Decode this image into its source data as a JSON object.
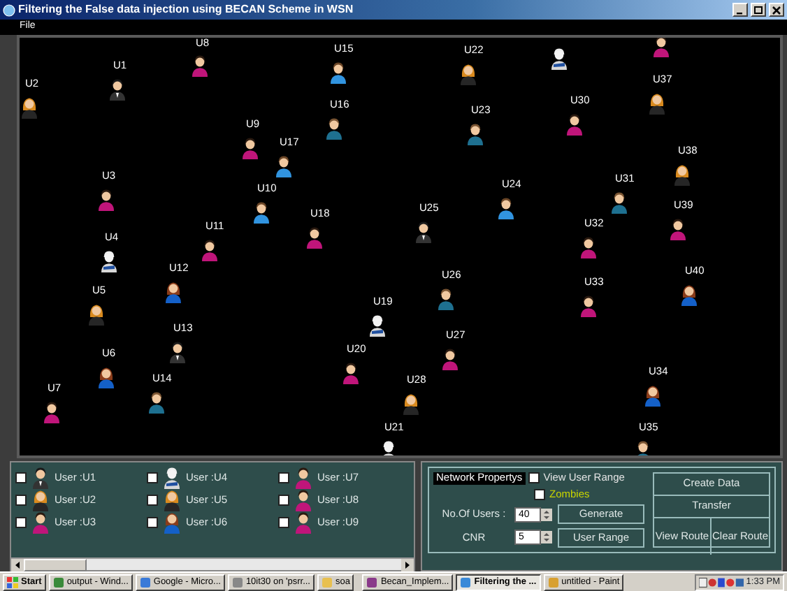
{
  "window": {
    "title": "Filtering the False data injection using BECAN Scheme in WSN"
  },
  "menu": [
    "File"
  ],
  "canvas": {
    "nodes": [
      {
        "label": "U1",
        "kind": "suit"
      },
      {
        "label": "U2",
        "kind": "blonde"
      },
      {
        "label": "U8",
        "kind": "lady"
      },
      {
        "label": "U15",
        "kind": "boy"
      },
      {
        "label": "U22",
        "kind": "blonde"
      },
      {
        "kind": "medic"
      },
      {
        "kind": "lady"
      },
      {
        "label": "U37",
        "kind": "blonde"
      },
      {
        "label": "U16",
        "kind": "man"
      },
      {
        "label": "U23",
        "kind": "man"
      },
      {
        "label": "U30",
        "kind": "lady"
      },
      {
        "label": "U9",
        "kind": "lady"
      },
      {
        "label": "U17",
        "kind": "boy"
      },
      {
        "label": "U38",
        "kind": "blonde"
      },
      {
        "label": "U3",
        "kind": "lady"
      },
      {
        "label": "U10",
        "kind": "boy"
      },
      {
        "label": "U24",
        "kind": "boy"
      },
      {
        "label": "U31",
        "kind": "man"
      },
      {
        "label": "U25",
        "kind": "suit"
      },
      {
        "label": "U18",
        "kind": "lady"
      },
      {
        "label": "U39",
        "kind": "lady"
      },
      {
        "label": "U11",
        "kind": "lady"
      },
      {
        "label": "U32",
        "kind": "lady"
      },
      {
        "label": "U4",
        "kind": "medic"
      },
      {
        "label": "U12",
        "kind": "nurse"
      },
      {
        "label": "U26",
        "kind": "man"
      },
      {
        "label": "U33",
        "kind": "lady"
      },
      {
        "label": "U40",
        "kind": "nurse"
      },
      {
        "label": "U5",
        "kind": "blonde"
      },
      {
        "label": "U19",
        "kind": "medic"
      },
      {
        "label": "U13",
        "kind": "suit"
      },
      {
        "label": "U27",
        "kind": "lady"
      },
      {
        "label": "U20",
        "kind": "lady"
      },
      {
        "label": "U6",
        "kind": "nurse"
      },
      {
        "label": "U34",
        "kind": "nurse"
      },
      {
        "label": "U14",
        "kind": "man"
      },
      {
        "label": "U28",
        "kind": "blonde"
      },
      {
        "label": "U7",
        "kind": "lady"
      },
      {
        "label": "U21",
        "kind": "medic"
      },
      {
        "label": "U35",
        "kind": "man"
      }
    ]
  },
  "users": [
    {
      "label": "User :U1",
      "kind": "suit",
      "checked": false
    },
    {
      "label": "User :U2",
      "kind": "blonde",
      "checked": false
    },
    {
      "label": "User :U3",
      "kind": "lady",
      "checked": false
    },
    {
      "label": "User :U4",
      "kind": "medic",
      "checked": false
    },
    {
      "label": "User :U5",
      "kind": "blonde",
      "checked": false
    },
    {
      "label": "User :U6",
      "kind": "nurse",
      "checked": false
    },
    {
      "label": "User :U7",
      "kind": "lady",
      "checked": false
    },
    {
      "label": "User :U8",
      "kind": "lady",
      "checked": false
    },
    {
      "label": "User :U9",
      "kind": "lady",
      "checked": false
    }
  ],
  "network": {
    "title": "Network Propertys",
    "options": [
      {
        "label": "View User Range",
        "checked": false,
        "color": "#e4e4e4"
      },
      {
        "label": "Zombies",
        "checked": false,
        "color": "#c8d400"
      }
    ],
    "fields": [
      {
        "label": "No.Of Users :",
        "value": "40",
        "button": "Generate"
      },
      {
        "label": "CNR",
        "value": "5",
        "button": "User Range"
      }
    ],
    "actions": [
      "Create Data",
      "Transfer",
      "View Route",
      "Clear Route"
    ]
  },
  "taskbar": {
    "start": "Start",
    "items": [
      {
        "label": "output - Wind...",
        "selected": false
      },
      {
        "label": "Google - Micro...",
        "selected": false
      },
      {
        "label": "10it30 on 'psrr...",
        "selected": false
      },
      {
        "label": "soa",
        "selected": false
      },
      {
        "label": "Becan_Implem...",
        "selected": false
      },
      {
        "label": "Filtering the ...",
        "selected": true
      },
      {
        "label": "untitled - Paint",
        "selected": false
      }
    ],
    "clock": "1:33 PM"
  }
}
